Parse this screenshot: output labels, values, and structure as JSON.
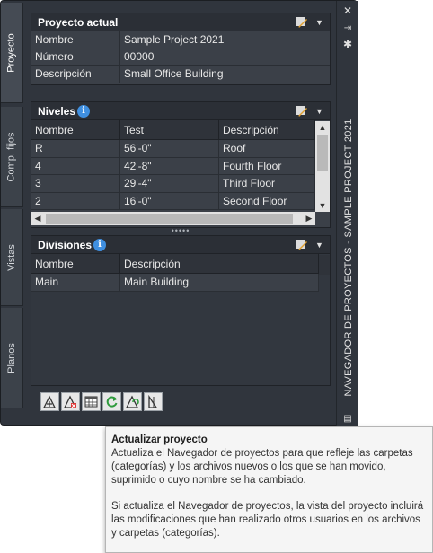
{
  "tabs": [
    {
      "label": "Proyecto"
    },
    {
      "label": "Comp. fijos"
    },
    {
      "label": "Vistas"
    },
    {
      "label": "Planos"
    }
  ],
  "project": {
    "header": "Proyecto actual",
    "rows": [
      {
        "key": "Nombre",
        "value": "Sample Project 2021"
      },
      {
        "key": "Número",
        "value": "00000"
      },
      {
        "key": "Descripción",
        "value": "Small Office Building"
      }
    ]
  },
  "levels": {
    "header": "Niveles",
    "columns": [
      "Nombre",
      "Test",
      "Descripción"
    ],
    "rows": [
      [
        "R",
        "56'-0\"",
        "Roof"
      ],
      [
        "4",
        "42'-8\"",
        "Fourth Floor"
      ],
      [
        "3",
        "29'-4\"",
        "Third Floor"
      ],
      [
        "2",
        "16'-0\"",
        "Second Floor"
      ]
    ]
  },
  "divisions": {
    "header": "Divisiones",
    "columns": [
      "Nombre",
      "Descripción"
    ],
    "rows": [
      [
        "Main",
        "Main Building"
      ]
    ]
  },
  "toolbar": {
    "buttons": [
      "add-level-icon",
      "delete-level-icon",
      "table-icon",
      "refresh-icon",
      "repath-icon",
      "elevation-icon"
    ]
  },
  "palette_title": "NAVEGADOR DE PROYECTOS - SAMPLE PROJECT 2021",
  "tooltip": {
    "title": "Actualizar proyecto",
    "para1": "Actualiza el Navegador de proyectos para que refleje las carpetas (categorías) y los archivos nuevos o los que se han movido, suprimido o cuyo nombre se ha cambiado.",
    "para2": "Si actualiza el Navegador de proyectos, la vista del proyecto incluirá las modificaciones que han realizado otros usuarios en los archivos y carpetas (categorías)."
  },
  "colors": {
    "palette_bg": "#30353d",
    "panel_bg": "#3b4048",
    "info_badge": "#3f8fe0",
    "refresh_green": "#2e9a3c"
  }
}
